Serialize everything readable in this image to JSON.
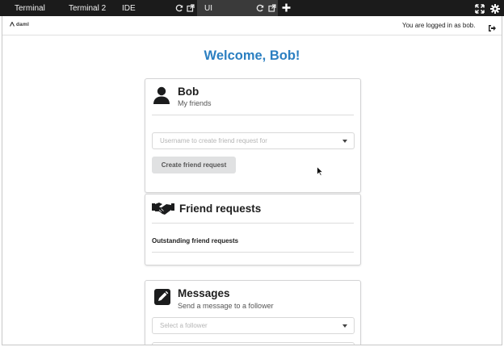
{
  "tabs": [
    {
      "label": "Terminal",
      "active": false
    },
    {
      "label": "Terminal 2",
      "active": false
    },
    {
      "label": "IDE",
      "active": false
    },
    {
      "label": "UI",
      "active": true
    }
  ],
  "icons": {
    "refresh": "refresh-icon",
    "external": "external-link-icon",
    "add_tab": "plus-icon",
    "fullscreen": "expand-icon",
    "settings": "gear-icon",
    "logout": "logout-icon"
  },
  "header": {
    "logo": "daml",
    "login_status": "You are logged in as bob."
  },
  "welcome": "Welcome, Bob!",
  "friends_card": {
    "title": "Bob",
    "subtitle": "My friends",
    "dropdown_placeholder": "Username to create friend request for",
    "button": "Create friend request"
  },
  "requests_card": {
    "title": "Friend requests",
    "section": "Outstanding friend requests"
  },
  "messages_card": {
    "title": "Messages",
    "subtitle": "Send a message to a follower",
    "dropdown_placeholder": "Select a follower"
  },
  "colors": {
    "accent": "#2b7fc1",
    "tabbar": "#1b1b1b",
    "button_bg": "#e0e1e2"
  }
}
